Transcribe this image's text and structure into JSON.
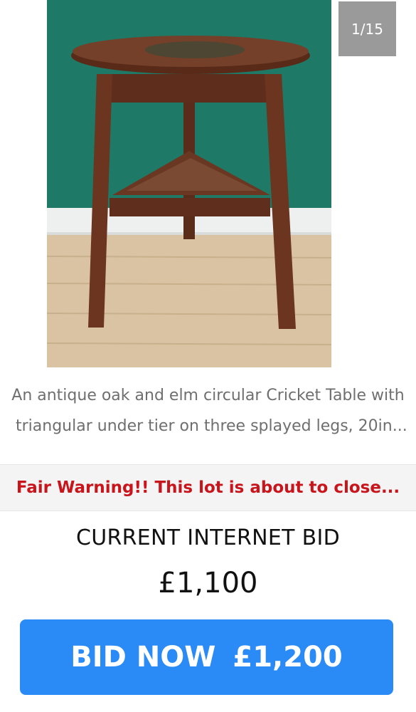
{
  "gallery": {
    "counter": "1/15",
    "image_alt": "Antique oak and elm cricket table"
  },
  "lot": {
    "description_line1": "An antique oak and elm circular Cricket Table with",
    "description_line2": "triangular under tier on three splayed legs, 20in..."
  },
  "status": {
    "warning": "Fair Warning!! This lot is about to close..."
  },
  "bidding": {
    "current_label": "CURRENT INTERNET BID",
    "current_amount": "£1,100",
    "button_label": "BID NOW",
    "button_amount": "£1,200"
  },
  "colors": {
    "warning_text": "#c8141b",
    "button_bg": "#2a8bf7",
    "counter_bg": "#9a9a9a"
  }
}
